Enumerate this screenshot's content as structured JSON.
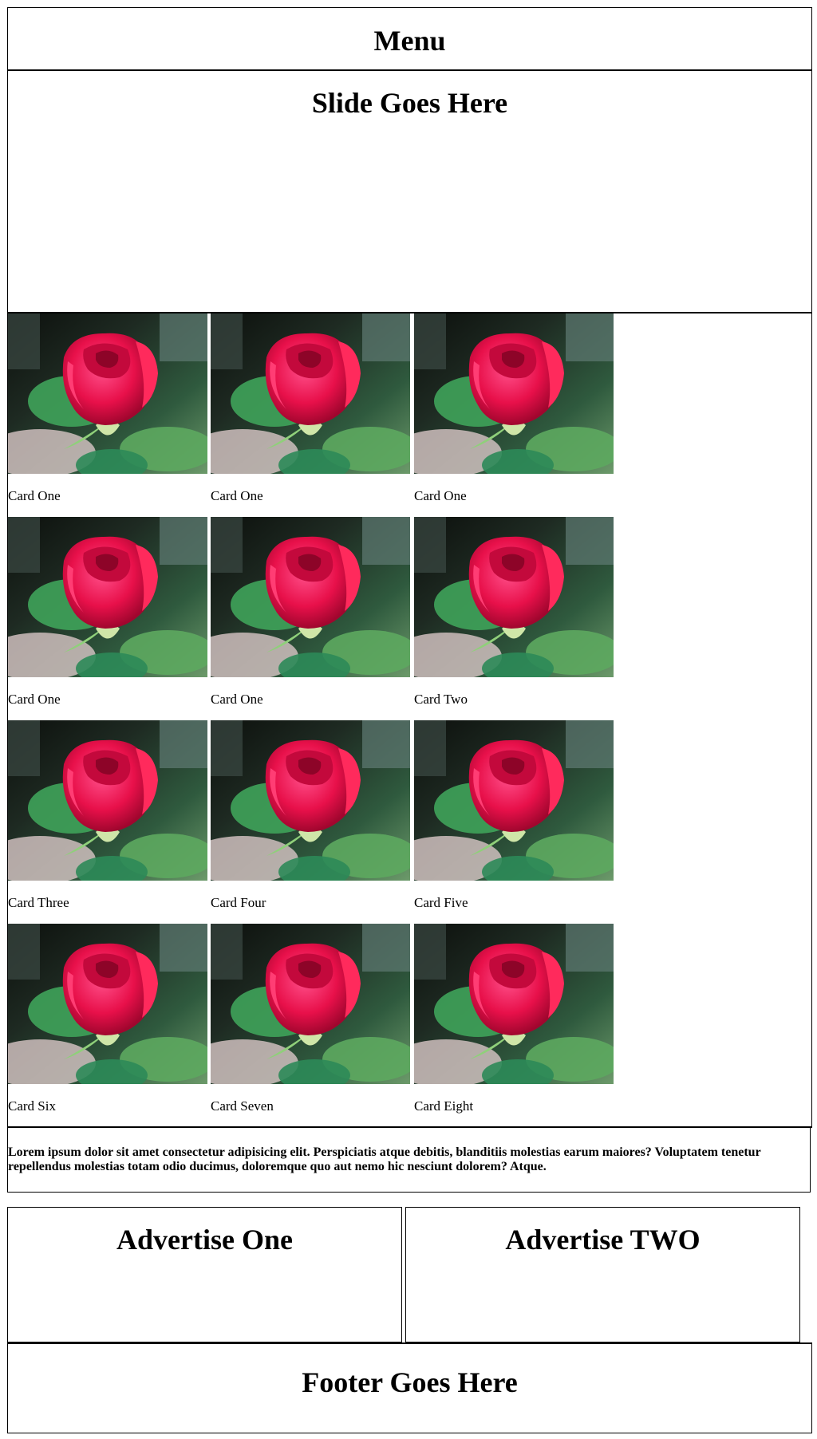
{
  "menu": {
    "title": "Menu"
  },
  "slide": {
    "title": "Slide Goes Here"
  },
  "cards": [
    {
      "label": "Card One",
      "image": "red-rose-photo"
    },
    {
      "label": "Card One",
      "image": "red-rose-photo"
    },
    {
      "label": "Card One",
      "image": "red-rose-photo"
    },
    {
      "label": "Card One",
      "image": "red-rose-photo"
    },
    {
      "label": "Card One",
      "image": "red-rose-photo"
    },
    {
      "label": "Card Two",
      "image": "red-rose-photo"
    },
    {
      "label": "Card Three",
      "image": "red-rose-photo"
    },
    {
      "label": "Card Four",
      "image": "red-rose-photo"
    },
    {
      "label": "Card Five",
      "image": "red-rose-photo"
    },
    {
      "label": "Card Six",
      "image": "red-rose-photo"
    },
    {
      "label": "Card Seven",
      "image": "red-rose-photo"
    },
    {
      "label": "Card Eight",
      "image": "red-rose-photo"
    }
  ],
  "lorem": {
    "text": "Lorem ipsum dolor sit amet consectetur adipisicing elit. Perspiciatis atque debitis, blanditiis molestias earum maiores? Voluptatem tenetur repellendus molestias totam odio ducimus, doloremque quo aut nemo hic nesciunt dolorem? Atque."
  },
  "ads": [
    {
      "title": "Advertise One"
    },
    {
      "title": "Advertise TWO"
    }
  ],
  "footer": {
    "title": "Footer Goes Here"
  },
  "colors": {
    "border": "#000000",
    "background": "#ffffff",
    "rose": "#e8104a",
    "leaf": "#3fa35a"
  }
}
